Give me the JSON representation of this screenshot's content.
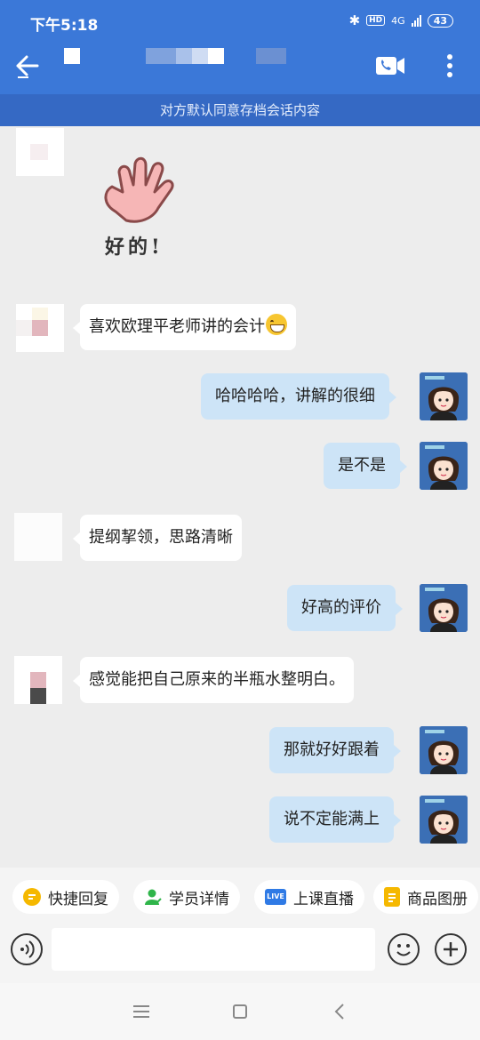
{
  "status_bar": {
    "time": "下午5:18",
    "hd": "HD",
    "network": "4G",
    "battery": "43"
  },
  "header": {
    "icons": [
      "back-arrow-icon",
      "video-call-icon",
      "more-vertical-icon"
    ]
  },
  "notice": "对方默认同意存档会话内容",
  "sticker": {
    "text": "好的!"
  },
  "messages": [
    {
      "side": "left",
      "text": "喜欢欧理平老师讲的会计"
    },
    {
      "side": "right",
      "text": "哈哈哈哈，讲解的很细"
    },
    {
      "side": "right",
      "text": "是不是"
    },
    {
      "side": "left",
      "text": "提纲挈领，思路清晰"
    },
    {
      "side": "right",
      "text": "好高的评价"
    },
    {
      "side": "left",
      "text": "感觉能把自己原来的半瓶水整明白。"
    },
    {
      "side": "right",
      "text": "那就好好跟着"
    },
    {
      "side": "right",
      "text": "说不定能满上"
    }
  ],
  "quick_actions": [
    {
      "label": "快捷回复",
      "icon": "quick-reply-icon",
      "color": "#f5b800"
    },
    {
      "label": "学员详情",
      "icon": "student-icon",
      "color": "#2fb54a"
    },
    {
      "label": "上课直播",
      "icon": "live-icon",
      "color": "#2f7ae5",
      "icon_text": "LIVE"
    },
    {
      "label": "商品图册",
      "icon": "catalog-icon",
      "color": "#f5b800"
    }
  ],
  "colors": {
    "header": "#3b78d8",
    "notice_bar": "#3569c4",
    "bubble_right": "#cde4f7",
    "bubble_left": "#ffffff",
    "background": "#ededed"
  }
}
